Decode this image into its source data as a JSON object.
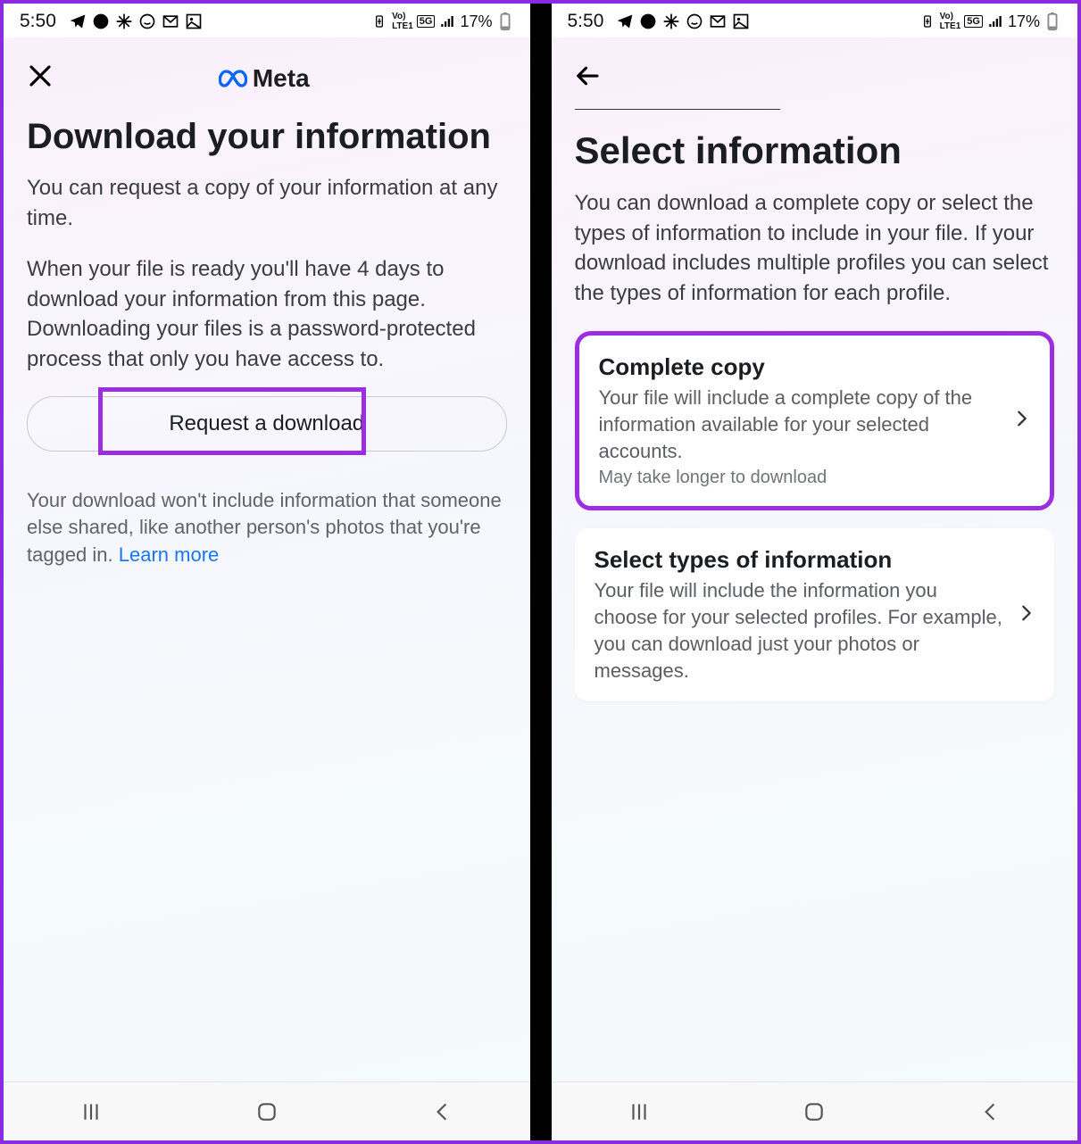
{
  "status": {
    "time": "5:50",
    "battery_text": "17%"
  },
  "left": {
    "brand": "Meta",
    "title": "Download your information",
    "intro1": "You can request a copy of your information at any time.",
    "intro2": "When your file is ready you'll have 4 days to download your information from this page. Downloading your files is a password-protected process that only you have access to.",
    "button": "Request a download",
    "footnote_pre": "Your download won't include information that someone else shared, like another person's photos that you're tagged in. ",
    "learn_more": "Learn more"
  },
  "right": {
    "title": "Select information",
    "intro": "You can download a complete copy or select the types of information to include in your file. If your download includes multiple profiles you can select the types of information for each profile.",
    "options": [
      {
        "title": "Complete copy",
        "desc": "Your file will include a complete copy of the information available for your selected accounts.",
        "note": "May take longer to download"
      },
      {
        "title": "Select types of information",
        "desc": "Your file will include the information you choose for your selected profiles. For example, you can download just your photos or messages.",
        "note": ""
      }
    ]
  }
}
